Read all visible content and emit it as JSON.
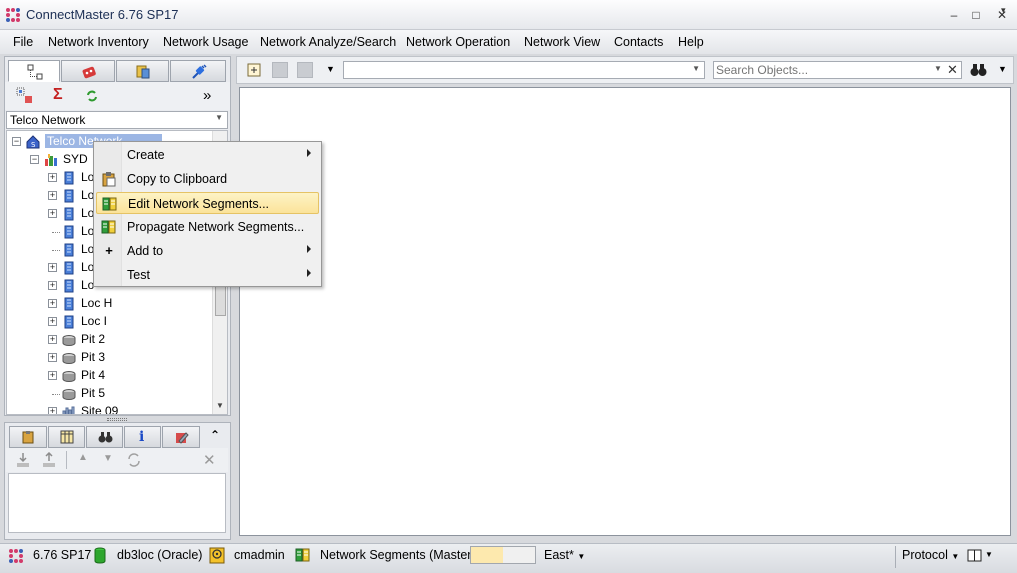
{
  "window": {
    "title": "ConnectMaster 6.76 SP17",
    "controls": {
      "minimize": "–",
      "restore": "□",
      "close": "✕"
    }
  },
  "menu": {
    "items": [
      "File",
      "Network Inventory",
      "Network Usage",
      "Network Analyze/Search",
      "Network Operation",
      "Network View",
      "Contacts",
      "Help"
    ]
  },
  "left_panel": {
    "tabs": [
      "tree-tab",
      "equipment-tab",
      "tools-tab",
      "connector-tab"
    ],
    "toolbar": {
      "more": "»"
    },
    "scope_select": "Telco Network",
    "tree": [
      {
        "label": "Telco Network",
        "icon": "network-root-icon",
        "selected": true
      },
      {
        "label": "SYD",
        "icon": "city-icon"
      },
      {
        "label": "Lo",
        "icon": "location-icon"
      },
      {
        "label": "Lo",
        "icon": "location-icon"
      },
      {
        "label": "Lo",
        "icon": "location-icon"
      },
      {
        "label": "Lo",
        "icon": "location-icon"
      },
      {
        "label": "Lo",
        "icon": "location-icon"
      },
      {
        "label": "Lo",
        "icon": "location-icon"
      },
      {
        "label": "Lo",
        "icon": "location-icon"
      },
      {
        "label": "Loc H",
        "icon": "location-icon"
      },
      {
        "label": "Loc I",
        "icon": "location-icon"
      },
      {
        "label": "Pit 2",
        "icon": "pit-icon"
      },
      {
        "label": "Pit 3",
        "icon": "pit-icon"
      },
      {
        "label": "Pit 4",
        "icon": "pit-icon"
      },
      {
        "label": "Pit 5",
        "icon": "pit-icon"
      },
      {
        "label": "Site 09",
        "icon": "site-icon"
      }
    ]
  },
  "bottom_panel": {
    "collapse": "⌃"
  },
  "right_panel": {
    "search_placeholder": "Search Objects..."
  },
  "context_menu": {
    "items": [
      {
        "label": "Create",
        "submenu": true,
        "icon": ""
      },
      {
        "label": "Copy to Clipboard",
        "submenu": false,
        "icon": "clipboard-icon"
      },
      {
        "label": "Edit Network Segments...",
        "submenu": false,
        "icon": "segments-icon",
        "highlighted": true
      },
      {
        "label": "Propagate Network Segments...",
        "submenu": false,
        "icon": "segments-icon"
      },
      {
        "label": "Add to",
        "submenu": true,
        "icon": "plus-icon"
      },
      {
        "label": "Test",
        "submenu": true,
        "icon": ""
      }
    ]
  },
  "status": {
    "version": "6.76 SP17",
    "database": "db3loc (Oracle)",
    "user": "cmadmin",
    "segments": "Network Segments (Master)",
    "progress_fraction": 0.5,
    "region": "East*",
    "protocol": "Protocol"
  },
  "colors": {
    "accent_highlight": "#fbe39a",
    "selection": "#9cb6e4",
    "title_text": "#1c2f55"
  }
}
